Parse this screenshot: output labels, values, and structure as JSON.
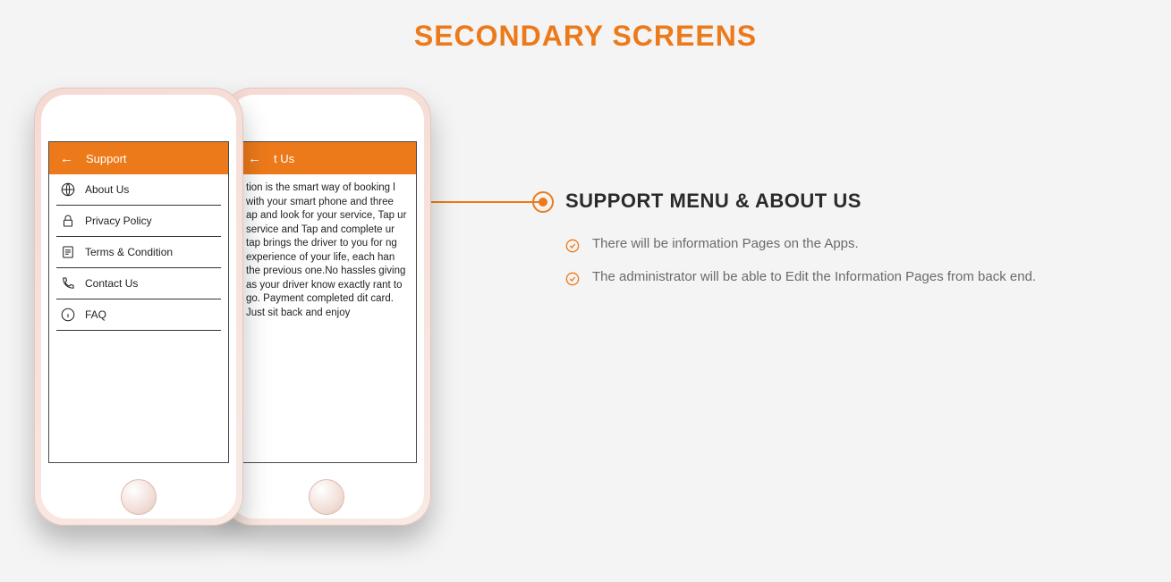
{
  "page_title": "SECONDARY SCREENS",
  "phone_front": {
    "appbar_title": "Support",
    "menu": [
      {
        "label": "About Us",
        "icon": "globe-icon"
      },
      {
        "label": "Privacy Policy",
        "icon": "lock-icon"
      },
      {
        "label": "Terms & Condition",
        "icon": "document-icon"
      },
      {
        "label": "Contact Us",
        "icon": "phone-icon"
      },
      {
        "label": "FAQ",
        "icon": "info-icon"
      }
    ]
  },
  "phone_back": {
    "appbar_title": "t Us",
    "content": "tion is the smart way of booking l with your smart phone and three ap and look for your service, Tap ur service and Tap and complete ur tap brings the driver to you for ng experience of your life, each han the previous one.No hassles giving as your driver know exactly rant to go. Payment completed dit card. Just sit back and enjoy"
  },
  "right": {
    "heading": "SUPPORT MENU & ABOUT US",
    "bullets": [
      "There will be information Pages on the Apps.",
      "The administrator will be able to Edit the Information Pages from back end."
    ]
  }
}
